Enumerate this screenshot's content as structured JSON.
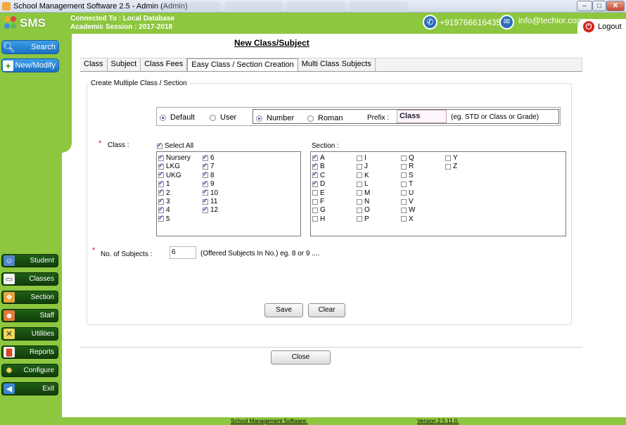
{
  "window": {
    "title": "School Management Software 2.5   - Admin (Admin)"
  },
  "header": {
    "brand": "SMS",
    "connected": "Connected To : Local Database",
    "session": "Academic Session : 2017-2018",
    "phone": "+919766616435",
    "email": "info@techior.com",
    "logout": "Logout"
  },
  "sidebar": {
    "top": [
      {
        "label": "Search",
        "icon": "search-icon"
      },
      {
        "label": "New/Modify",
        "icon": "new-modify-icon"
      }
    ],
    "nav": [
      {
        "label": "Student",
        "icon": "student-icon"
      },
      {
        "label": "Classes",
        "icon": "classes-icon"
      },
      {
        "label": "Section",
        "icon": "section-icon"
      },
      {
        "label": "Staff",
        "icon": "staff-icon"
      },
      {
        "label": "Utilities",
        "icon": "utilities-icon"
      },
      {
        "label": "Reports",
        "icon": "reports-icon"
      },
      {
        "label": "Configure",
        "icon": "configure-icon"
      },
      {
        "label": "Exit",
        "icon": "exit-icon"
      }
    ]
  },
  "page": {
    "title": "New Class/Subject"
  },
  "tabs": [
    "Class",
    "Subject",
    "Class Fees",
    "Easy Class / Section Creation",
    "Multi Class Subjects"
  ],
  "active_tab": "Easy Class / Section Creation",
  "form": {
    "group_title": "Create Multiple Class / Section",
    "mode_options": [
      {
        "label": "Default",
        "selected": true
      },
      {
        "label": "User",
        "selected": false
      }
    ],
    "numbering_options": [
      {
        "label": "Number",
        "selected": true
      },
      {
        "label": "Roman",
        "selected": false
      }
    ],
    "prefix_label": "Prefix :",
    "prefix_value": "Class",
    "prefix_hint": "(eg. STD or Class or Grade)",
    "required_mark": "*",
    "class_label": "Class :",
    "select_all": {
      "label": "Select All",
      "checked": true
    },
    "classes": [
      {
        "label": "Nursery",
        "checked": true
      },
      {
        "label": "LKG",
        "checked": true
      },
      {
        "label": "UKG",
        "checked": true
      },
      {
        "label": "1",
        "checked": true
      },
      {
        "label": "2",
        "checked": true
      },
      {
        "label": "3",
        "checked": true
      },
      {
        "label": "4",
        "checked": true
      },
      {
        "label": "5",
        "checked": true
      },
      {
        "label": "6",
        "checked": true
      },
      {
        "label": "7",
        "checked": true
      },
      {
        "label": "8",
        "checked": true
      },
      {
        "label": "9",
        "checked": true
      },
      {
        "label": "10",
        "checked": true
      },
      {
        "label": "11",
        "checked": true
      },
      {
        "label": "12",
        "checked": true
      }
    ],
    "section_label": "Section :",
    "sections": [
      {
        "label": "A",
        "checked": true
      },
      {
        "label": "B",
        "checked": true
      },
      {
        "label": "C",
        "checked": true
      },
      {
        "label": "D",
        "checked": true
      },
      {
        "label": "E",
        "checked": false
      },
      {
        "label": "F",
        "checked": false
      },
      {
        "label": "G",
        "checked": false
      },
      {
        "label": "H",
        "checked": false
      },
      {
        "label": "I",
        "checked": false
      },
      {
        "label": "J",
        "checked": false
      },
      {
        "label": "K",
        "checked": false
      },
      {
        "label": "L",
        "checked": false
      },
      {
        "label": "M",
        "checked": false
      },
      {
        "label": "N",
        "checked": false
      },
      {
        "label": "O",
        "checked": false
      },
      {
        "label": "P",
        "checked": false
      },
      {
        "label": "Q",
        "checked": false
      },
      {
        "label": "R",
        "checked": false
      },
      {
        "label": "S",
        "checked": false
      },
      {
        "label": "T",
        "checked": false
      },
      {
        "label": "U",
        "checked": false
      },
      {
        "label": "V",
        "checked": false
      },
      {
        "label": "W",
        "checked": false
      },
      {
        "label": "X",
        "checked": false
      },
      {
        "label": "Y",
        "checked": false
      },
      {
        "label": "Z",
        "checked": false
      }
    ],
    "subjects_label": "No. of Subjects :",
    "subjects_value": "6",
    "subjects_hint": "(Offered Subjects In No.) eg. 8 or 9 ....",
    "save": "Save",
    "clear": "Clear"
  },
  "close": "Close",
  "footer": {
    "left": "School Management Software.",
    "right": "Version 2.5.11.0."
  }
}
